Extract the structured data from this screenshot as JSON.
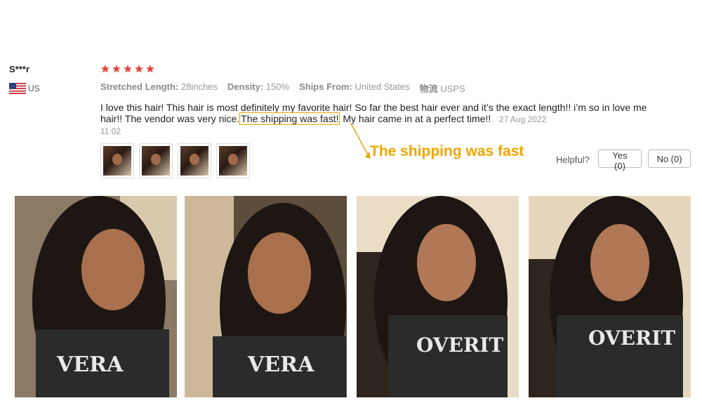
{
  "review": {
    "reviewer_name": "S***r",
    "country_code": "US",
    "rating": 5,
    "properties": [
      {
        "key": "Stretched Length:",
        "value": "28inches"
      },
      {
        "key": "Density:",
        "value": "150%"
      },
      {
        "key": "Ships From:",
        "value": "United States"
      },
      {
        "key": "物流",
        "value": "USPS"
      }
    ],
    "text_before": "I love this hair! This hair is most definitely my favorite hair!  So far the best hair ever and it’s the exact length!! i’m so in love me hair!! The vendor was very nice.",
    "text_highlight": "The shipping was fast!",
    "text_after": " My hair came in at a perfect time!!",
    "date": "27 Aug 2022",
    "time": "11:02"
  },
  "annotation": {
    "text": "The shipping was fast",
    "color": "#f0a500"
  },
  "helpful": {
    "label": "Helpful?",
    "yes_label": "Yes (0)",
    "no_label": "No (0)"
  },
  "colors": {
    "star": "#e8473c",
    "highlight_border": "#e8a700"
  },
  "thumbnail_count": 4,
  "photo_count": 4
}
